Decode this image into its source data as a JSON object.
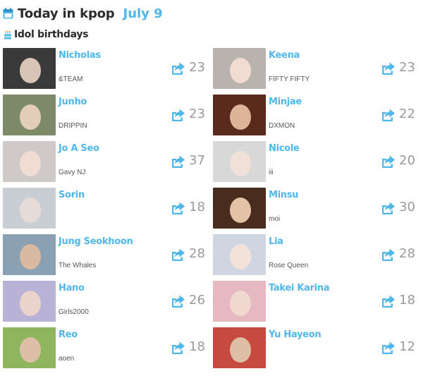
{
  "header": {
    "title": "Today in kpop",
    "date": "July 9",
    "icon": "calendar-icon"
  },
  "section": {
    "title": "Idol birthdays",
    "icon": "cake-icon"
  },
  "colors": {
    "accent": "#4fb7ea",
    "count": "#9a9a9a",
    "text": "#2b2b2b"
  },
  "left_column": [
    {
      "name": "Nicholas",
      "group": "&TEAM",
      "count": "23",
      "bg": "#3a3a3a",
      "skin": "#d9c5b8"
    },
    {
      "name": "Junho",
      "group": "DRIPPIN",
      "count": "23",
      "bg": "#7c8a6a",
      "skin": "#e3cdb9"
    },
    {
      "name": "Jo A Seo",
      "group": "Gavy NJ",
      "count": "37",
      "bg": "#cfc9c8",
      "skin": "#efdcd2"
    },
    {
      "name": "Sorin",
      "group": "",
      "count": "18",
      "bg": "#c9ced5",
      "skin": "#e6dbd6"
    },
    {
      "name": "Jung Seokhoon",
      "group": "The Whales",
      "count": "28",
      "bg": "#8aa1b3",
      "skin": "#d9b9a0"
    },
    {
      "name": "Hano",
      "group": "Girls2000",
      "count": "26",
      "bg": "#b8b2d6",
      "skin": "#e9d3cb"
    },
    {
      "name": "Reo",
      "group": "aoen",
      "count": "18",
      "bg": "#8fb55e",
      "skin": "#dcbfa6"
    }
  ],
  "right_column": [
    {
      "name": "Keena",
      "group": "FIFTY FIFTY",
      "count": "23",
      "bg": "#b9b3b0",
      "skin": "#f0dcd0"
    },
    {
      "name": "Minjae",
      "group": "DXMON",
      "count": "22",
      "bg": "#5a2a1d",
      "skin": "#dcb598"
    },
    {
      "name": "Nicole",
      "group": "iii",
      "count": "20",
      "bg": "#d8d8d8",
      "skin": "#f0e0d8"
    },
    {
      "name": "Minsu",
      "group": "moi",
      "count": "30",
      "bg": "#4a2c1f",
      "skin": "#e3c2a6"
    },
    {
      "name": "Lia",
      "group": "Rose Queen",
      "count": "28",
      "bg": "#cfd6e2",
      "skin": "#f2e2da"
    },
    {
      "name": "Takei Karina",
      "group": "",
      "count": "18",
      "bg": "#e6b9c2",
      "skin": "#f0d8cf"
    },
    {
      "name": "Yu Hayeon",
      "group": "",
      "count": "12",
      "bg": "#c64a3f",
      "skin": "#dfbea6"
    }
  ]
}
